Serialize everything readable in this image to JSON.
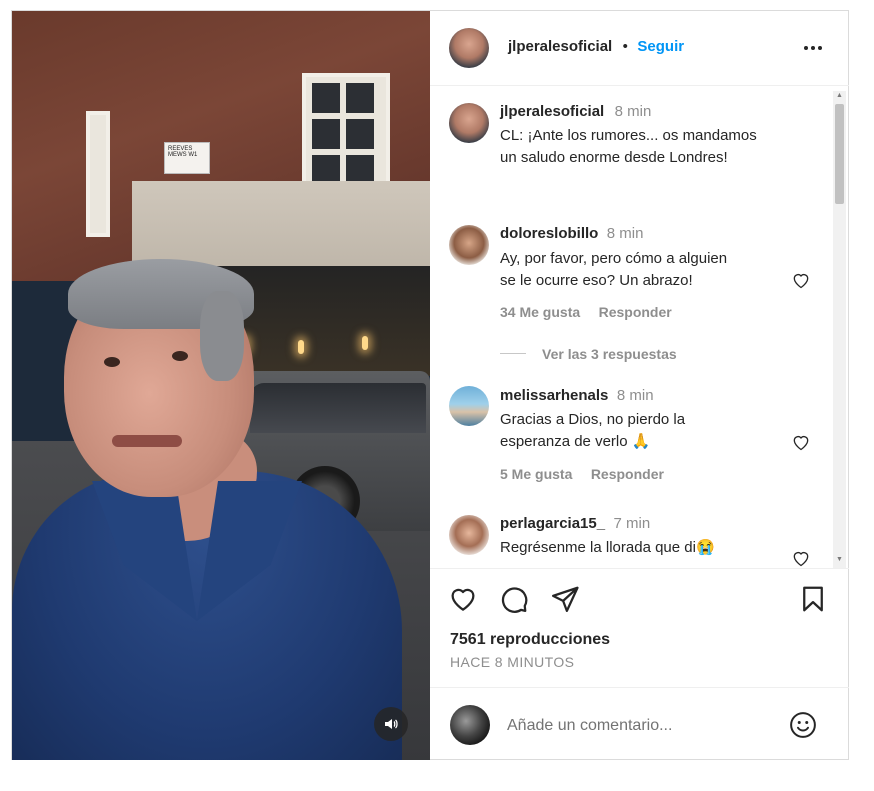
{
  "header": {
    "username": "jlperalesoficial",
    "separator": "•",
    "follow_label": "Seguir",
    "more_icon": "more-horizontal-icon"
  },
  "caption": {
    "username": "jlperalesoficial",
    "time": "8 min",
    "text_line1": "CL: ¡Ante los rumores... os mandamos",
    "text_line2": "un saludo enorme desde Londres!"
  },
  "comments": [
    {
      "username": "doloreslobillo",
      "time": "8 min",
      "line1": "Ay, por favor, pero cómo a alguien",
      "line2": "se le ocurre eso? Un abrazo!",
      "likes": "34 Me gusta",
      "reply_label": "Responder",
      "view_replies": "Ver las 3 respuestas"
    },
    {
      "username": "melissarhenals",
      "time": "8 min",
      "line1": "Gracias a Dios, no pierdo la",
      "line2": "esperanza de verlo 🙏",
      "likes": "5 Me gusta",
      "reply_label": "Responder"
    },
    {
      "username": "perlagarcia15_",
      "time": "7 min",
      "line1": "Regrésenme la llorada que di😭"
    }
  ],
  "actions": {
    "like_icon": "heart-icon",
    "comment_icon": "comment-icon",
    "share_icon": "send-icon",
    "save_icon": "bookmark-icon"
  },
  "stats": {
    "views": "7561 reproducciones",
    "posted": "HACE 8 MINUTOS"
  },
  "composer": {
    "placeholder": "Añade un comentario...",
    "emoji_icon": "smiley-icon"
  },
  "media": {
    "mute_icon": "speaker-icon",
    "street_sign": "REEVES MEWS W1"
  },
  "colors": {
    "follow": "#0095f6",
    "text": "#262626",
    "secondary": "#8e8e8e"
  }
}
